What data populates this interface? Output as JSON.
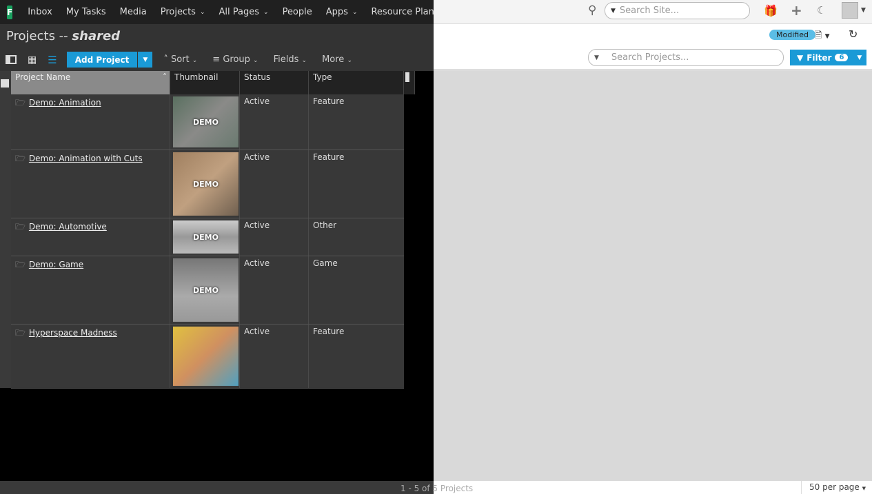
{
  "nav": {
    "logo": "F",
    "items": [
      {
        "label": "Inbox"
      },
      {
        "label": "My Tasks"
      },
      {
        "label": "Media"
      },
      {
        "label": "Projects",
        "dropdown": true
      },
      {
        "label": "All Pages",
        "dropdown": true
      },
      {
        "label": "People"
      },
      {
        "label": "Apps",
        "dropdown": true
      },
      {
        "label": "Resource Planning"
      }
    ],
    "search_placeholder": "Search Site..."
  },
  "page": {
    "title": "Projects --",
    "title_suffix": "shared",
    "status_badge": "Modified"
  },
  "toolbar": {
    "add_label": "Add Project",
    "sort": "Sort",
    "group": "Group",
    "fields": "Fields",
    "more": "More",
    "search_placeholder": "Search Projects...",
    "filter": "Filter",
    "filter_count": "6"
  },
  "columns": [
    "Project Name",
    "Thumbnail",
    "Status",
    "Type"
  ],
  "rows": [
    {
      "name": "Demo: Animation",
      "thumb": "DEMO",
      "status": "Active",
      "type": "Feature"
    },
    {
      "name": "Demo: Animation with Cuts",
      "thumb": "DEMO",
      "status": "Active",
      "type": "Feature"
    },
    {
      "name": "Demo: Automotive",
      "thumb": "DEMO",
      "status": "Active",
      "type": "Other"
    },
    {
      "name": "Demo: Game",
      "thumb": "DEMO",
      "status": "Active",
      "type": "Game"
    },
    {
      "name": "Hyperspace Madness",
      "thumb": "",
      "status": "Active",
      "type": "Feature"
    }
  ],
  "footer": {
    "count": "1 - 5 of 5 Projects",
    "per_page": "50 per page"
  },
  "colors": {
    "accent": "#1a9ad6",
    "badge": "#5bbde6"
  }
}
